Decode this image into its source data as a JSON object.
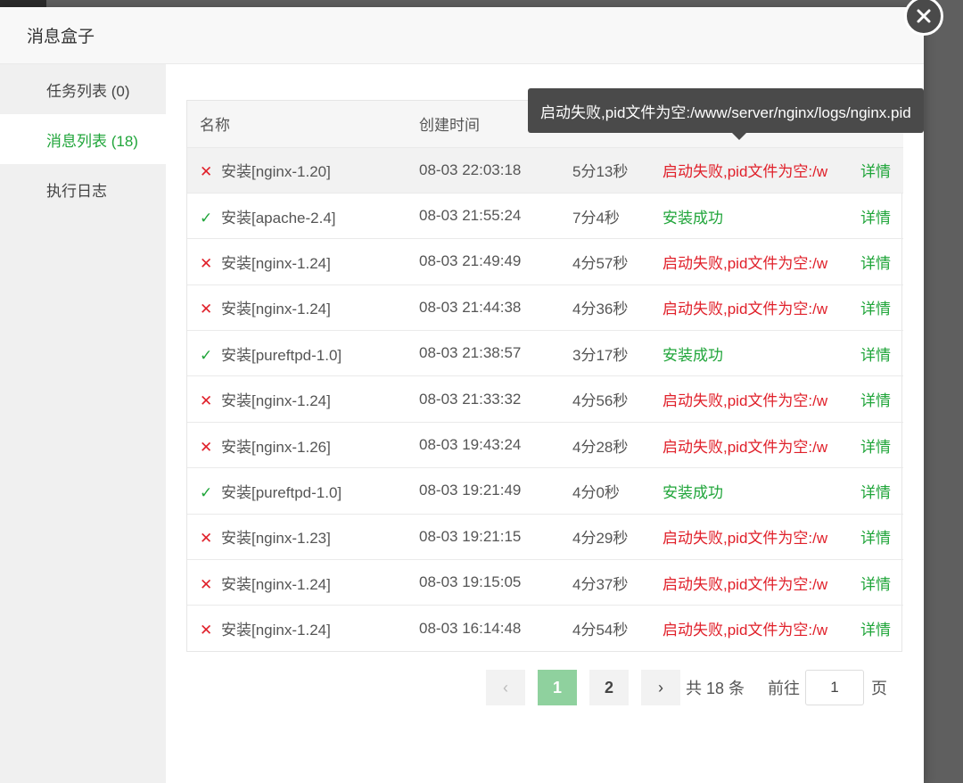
{
  "dialog": {
    "title": "消息盒子"
  },
  "sidebar": {
    "items": [
      {
        "label": "任务列表 (0)"
      },
      {
        "label": "消息列表 (18)"
      },
      {
        "label": "执行日志"
      }
    ]
  },
  "table": {
    "columns": [
      "名称",
      "创建时间",
      "",
      "",
      ""
    ],
    "rows": [
      {
        "status": "fail",
        "name": "安装[nginx-1.20]",
        "created": "08-03 22:03:18",
        "duration": "5分13秒",
        "message": "启动失败,pid文件为空:/w",
        "action": "详情"
      },
      {
        "status": "ok",
        "name": "安装[apache-2.4]",
        "created": "08-03 21:55:24",
        "duration": "7分4秒",
        "message": "安装成功",
        "action": "详情"
      },
      {
        "status": "fail",
        "name": "安装[nginx-1.24]",
        "created": "08-03 21:49:49",
        "duration": "4分57秒",
        "message": "启动失败,pid文件为空:/w",
        "action": "详情"
      },
      {
        "status": "fail",
        "name": "安装[nginx-1.24]",
        "created": "08-03 21:44:38",
        "duration": "4分36秒",
        "message": "启动失败,pid文件为空:/w",
        "action": "详情"
      },
      {
        "status": "ok",
        "name": "安装[pureftpd-1.0]",
        "created": "08-03 21:38:57",
        "duration": "3分17秒",
        "message": "安装成功",
        "action": "详情"
      },
      {
        "status": "fail",
        "name": "安装[nginx-1.24]",
        "created": "08-03 21:33:32",
        "duration": "4分56秒",
        "message": "启动失败,pid文件为空:/w",
        "action": "详情"
      },
      {
        "status": "fail",
        "name": "安装[nginx-1.26]",
        "created": "08-03 19:43:24",
        "duration": "4分28秒",
        "message": "启动失败,pid文件为空:/w",
        "action": "详情"
      },
      {
        "status": "ok",
        "name": "安装[pureftpd-1.0]",
        "created": "08-03 19:21:49",
        "duration": "4分0秒",
        "message": "安装成功",
        "action": "详情"
      },
      {
        "status": "fail",
        "name": "安装[nginx-1.23]",
        "created": "08-03 19:21:15",
        "duration": "4分29秒",
        "message": "启动失败,pid文件为空:/w",
        "action": "详情"
      },
      {
        "status": "fail",
        "name": "安装[nginx-1.24]",
        "created": "08-03 19:15:05",
        "duration": "4分37秒",
        "message": "启动失败,pid文件为空:/w",
        "action": "详情"
      },
      {
        "status": "fail",
        "name": "安装[nginx-1.24]",
        "created": "08-03 16:14:48",
        "duration": "4分54秒",
        "message": "启动失败,pid文件为空:/w",
        "action": "详情"
      }
    ]
  },
  "tooltip": {
    "text": "启动失败,pid文件为空:/www/server/nginx/logs/nginx.pid"
  },
  "pagination": {
    "prev": "‹",
    "pages": [
      "1",
      "2"
    ],
    "current": "1",
    "next": "›",
    "total": "共 18 条",
    "goto_label": "前往",
    "goto_value": "1",
    "goto_suffix": "页"
  },
  "colors": {
    "accent": "#20a53a",
    "error": "#e0202a",
    "current_page": "#8fd19e"
  },
  "icons": {
    "fail": "cross-icon",
    "ok": "check-icon",
    "close": "close-icon"
  }
}
